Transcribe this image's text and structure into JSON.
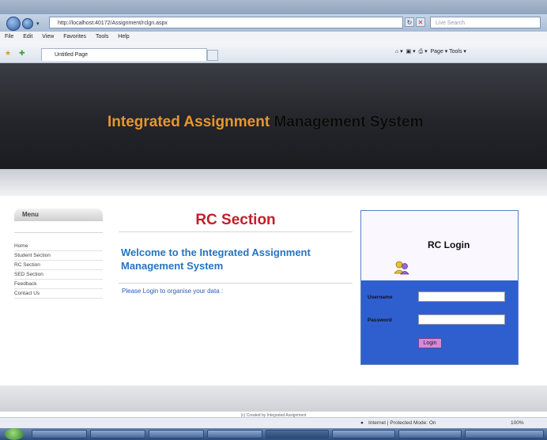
{
  "browser": {
    "address": "http://localhost:40172/Assignment/rclgn.aspx",
    "search_placeholder": "Live Search",
    "menus": [
      "File",
      "Edit",
      "View",
      "Favorites",
      "Tools",
      "Help"
    ],
    "tab_title": "Untitled Page",
    "commands": "Page ▾  Tools ▾",
    "status_text": "Internet | Protected Mode: On",
    "zoom": "100%"
  },
  "site": {
    "title_part1": "Integrated Assignment",
    "title_part2": "Management System"
  },
  "menu": {
    "heading": "Menu",
    "items": [
      "Home",
      "Student Section",
      "RC Section",
      "SED Section",
      "Feedback",
      "Contact Us"
    ]
  },
  "main": {
    "section_title": "RC Section",
    "welcome_line1": "Welcome to the Integrated Assignment",
    "welcome_line2": "Management System",
    "instruction": "Please Login to organise your data :"
  },
  "login": {
    "title": "RC Login",
    "username_label": "Username",
    "password_label": "Password",
    "button_label": "Login",
    "username_value": "",
    "password_value": ""
  },
  "footer": {
    "text": "(c) Created by Integrated Assignment"
  }
}
